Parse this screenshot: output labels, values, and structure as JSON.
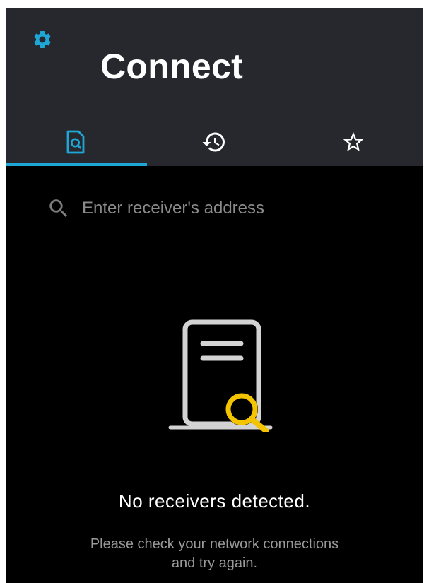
{
  "app": {
    "title": "Connect"
  },
  "header": {
    "settings_icon": "gear-icon"
  },
  "tabs": [
    {
      "name": "discover",
      "icon": "document-search-icon",
      "active": true
    },
    {
      "name": "history",
      "icon": "history-icon",
      "active": false
    },
    {
      "name": "favorites",
      "icon": "star-outline-icon",
      "active": false
    }
  ],
  "search": {
    "placeholder": "Enter receiver's address",
    "value": "",
    "icon": "search-icon"
  },
  "empty_state": {
    "illustration": "document-magnifier-illustration",
    "title": "No receivers detected.",
    "message_line1": "Please check your network connections",
    "message_line2": "and try again."
  },
  "colors": {
    "accent": "#1ea7d6",
    "appbar_background": "#27282d",
    "background": "#000000",
    "illustration_magnifier": "#f5c400",
    "illustration_document": "#d3d3d3"
  }
}
